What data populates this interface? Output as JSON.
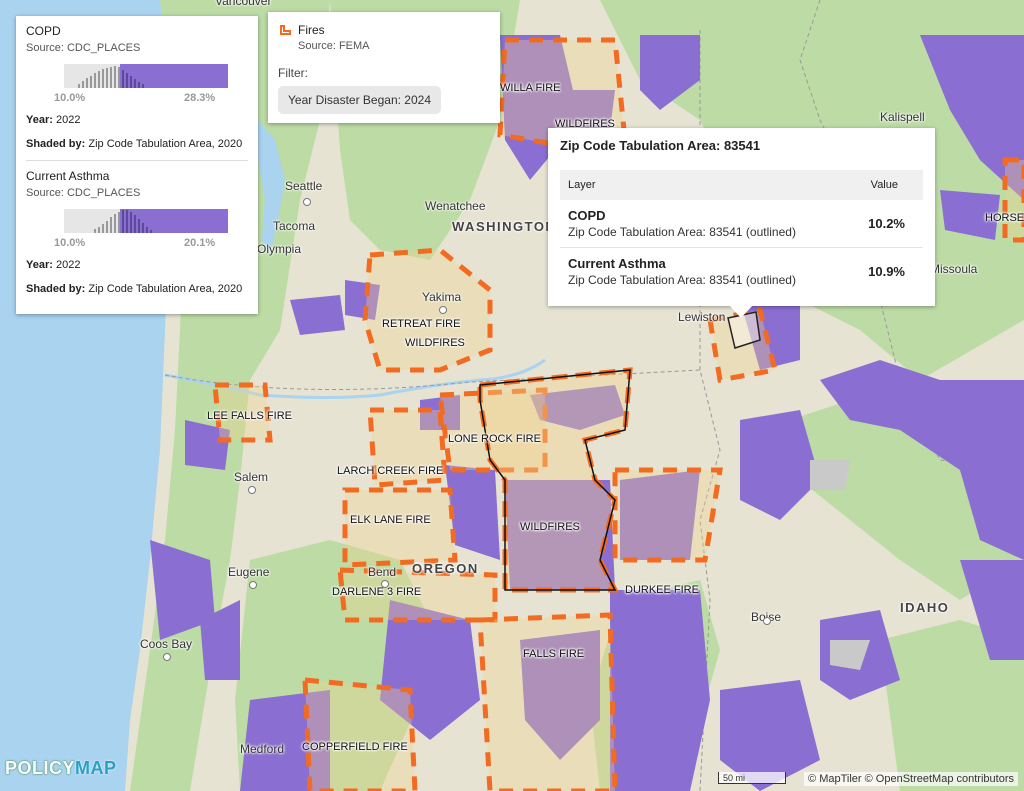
{
  "legend": {
    "layers": [
      {
        "title": "COPD",
        "source": "Source: CDC_PLACES",
        "min_label": "10.0%",
        "max_label": "28.3%",
        "year_label": "Year:",
        "year": "2022",
        "shaded_label": "Shaded by:",
        "shaded_value": "Zip Code Tabulation Area, 2020"
      },
      {
        "title": "Current Asthma",
        "source": "Source: CDC_PLACES",
        "min_label": "10.0%",
        "max_label": "20.1%",
        "year_label": "Year:",
        "year": "2022",
        "shaded_label": "Shaded by:",
        "shaded_value": "Zip Code Tabulation Area, 2020"
      }
    ],
    "fill_color": "#8a6ed2"
  },
  "fires_panel": {
    "title": "Fires",
    "source": "Source: FEMA",
    "filter_label": "Filter:",
    "filter_chip": "Year Disaster Began: 2024",
    "icon": "fire-polygon-icon",
    "color": "#f26b21"
  },
  "popup": {
    "title": "Zip Code Tabulation Area: 83541",
    "col_layer": "Layer",
    "col_value": "Value",
    "rows": [
      {
        "name": "COPD",
        "sub": "Zip Code Tabulation Area: 83541 (outlined)",
        "value": "10.2%"
      },
      {
        "name": "Current Asthma",
        "sub": "Zip Code Tabulation Area: 83541 (outlined)",
        "value": "10.9%"
      }
    ]
  },
  "map": {
    "cities": [
      "Vancouver",
      "Seattle",
      "Tacoma",
      "Olympia",
      "Wenatchee",
      "Yakima",
      "Kalispell",
      "Missoula",
      "Lewiston",
      "Salem",
      "Eugene",
      "Bend",
      "Coos Bay",
      "Medford",
      "Boise"
    ],
    "states": [
      "WASHINGTON",
      "OREGON",
      "IDAHO"
    ],
    "fires": [
      "WILLA FIRE",
      "WILDFIRES",
      "HORSE",
      "RETREAT FIRE",
      "WILDFIRES",
      "LEE FALLS FIRE",
      "LONE ROCK FIRE",
      "LARCH CREEK FIRE",
      "WILDFIRES",
      "ELK LANE FIRE",
      "DARLENE 3 FIRE",
      "DURKEE FIRE",
      "FALLS FIRE",
      "COPPERFIELD FIRE"
    ],
    "colors": {
      "water": "#a9d3ee",
      "land_green": "#bcdba5",
      "land_tan": "#e9e3cf",
      "fire_outline": "#f26b21",
      "zcta_fill": "#8a6ed2"
    }
  },
  "branding": {
    "logo_part1": "POLICY",
    "logo_part2": "MAP"
  },
  "scale_label": "50 mi",
  "attribution": "© MapTiler © OpenStreetMap contributors"
}
